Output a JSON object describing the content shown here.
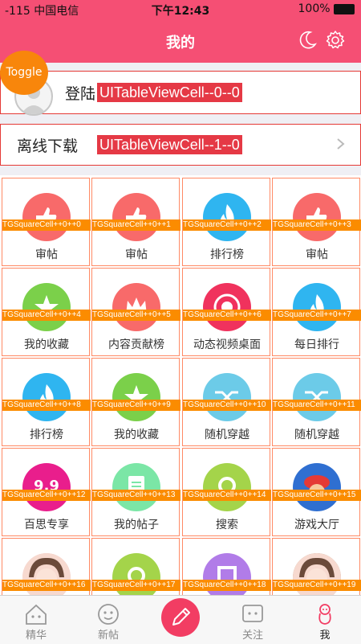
{
  "status": {
    "carrier": "-115 中国电信",
    "time": "下午12:43",
    "battery": "100%"
  },
  "nav": {
    "title": "我的"
  },
  "toggle": {
    "label": "Toggle"
  },
  "cells": [
    {
      "text": "登陆",
      "tag": "UITableViewCell--0--0"
    },
    {
      "text": "离线下载",
      "tag": "UITableViewCell--1--0"
    }
  ],
  "squares": [
    {
      "label": "审帖",
      "tag": "TGSquareCell++0++0",
      "icon": "thumbs-up-icon",
      "color": "#f86a6a"
    },
    {
      "label": "审帖",
      "tag": "TGSquareCell++0++1",
      "icon": "thumbs-up-icon",
      "color": "#f86a6a"
    },
    {
      "label": "排行榜",
      "tag": "TGSquareCell++0++2",
      "icon": "flame-icon",
      "color": "#2fb5f0"
    },
    {
      "label": "审帖",
      "tag": "TGSquareCell++0++3",
      "icon": "thumbs-up-icon",
      "color": "#f86a6a"
    },
    {
      "label": "我的收藏",
      "tag": "TGSquareCell++0++4",
      "icon": "star-icon",
      "color": "#7bd04a"
    },
    {
      "label": "内容贡献榜",
      "tag": "TGSquareCell++0++5",
      "icon": "crown-icon",
      "color": "#f86a6a"
    },
    {
      "label": "动态视频桌面",
      "tag": "TGSquareCell++0++6",
      "icon": "video-icon",
      "color": "#f0325d"
    },
    {
      "label": "每日排行",
      "tag": "TGSquareCell++0++7",
      "icon": "flame-icon",
      "color": "#2fb5f0"
    },
    {
      "label": "排行榜",
      "tag": "TGSquareCell++0++8",
      "icon": "flame-icon",
      "color": "#2fb5f0"
    },
    {
      "label": "我的收藏",
      "tag": "TGSquareCell++0++9",
      "icon": "star-icon",
      "color": "#7bd04a"
    },
    {
      "label": "随机穿越",
      "tag": "TGSquareCell++0++10",
      "icon": "shuffle-icon",
      "color": "#6ccbe8"
    },
    {
      "label": "随机穿越",
      "tag": "TGSquareCell++0++11",
      "icon": "shuffle-icon",
      "color": "#6ccbe8"
    },
    {
      "label": "百思专享",
      "tag": "TGSquareCell++0++12",
      "icon": "badge-99-icon",
      "color": "#e91e8c"
    },
    {
      "label": "我的帖子",
      "tag": "TGSquareCell++0++13",
      "icon": "document-icon",
      "color": "#7be6a6"
    },
    {
      "label": "搜索",
      "tag": "TGSquareCell++0++14",
      "icon": "search-icon",
      "color": "#a4d44a"
    },
    {
      "label": "游戏大厅",
      "tag": "TGSquareCell++0++15",
      "icon": "mario-icon",
      "color": "#2f6fd1"
    },
    {
      "label": "",
      "tag": "TGSquareCell++0++16",
      "icon": "girl-photo-icon",
      "color": "#f3c7c0"
    },
    {
      "label": "",
      "tag": "TGSquareCell++0++17",
      "icon": "search-icon",
      "color": "#a4d44a"
    },
    {
      "label": "",
      "tag": "TGSquareCell++0++18",
      "icon": "frame-icon",
      "color": "#b17ce8"
    },
    {
      "label": "",
      "tag": "TGSquareCell++0++19",
      "icon": "girl-photo-icon",
      "color": "#c8a58a"
    }
  ],
  "tabs": [
    {
      "label": "精华",
      "icon": "house-icon"
    },
    {
      "label": "新帖",
      "icon": "smiley-icon"
    },
    {
      "label": "",
      "icon": "pencil-icon"
    },
    {
      "label": "关注",
      "icon": "chat-icon"
    },
    {
      "label": "我",
      "icon": "person-icon"
    }
  ],
  "colors": {
    "primary": "#f54f74",
    "tag": "#e53945",
    "square_tag": "#fb8c00",
    "toggle": "#f8860b"
  }
}
